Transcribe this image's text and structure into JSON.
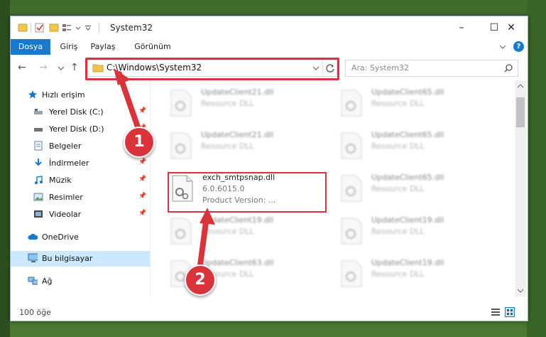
{
  "window": {
    "title": "System32",
    "controls": {
      "minimize": "–",
      "maximize": "☐",
      "close": "✕"
    }
  },
  "ribbon": {
    "tabs": [
      "Dosya",
      "Giriş",
      "Paylaş",
      "Görünüm"
    ],
    "active_tab": "Dosya",
    "help": "?"
  },
  "nav": {
    "address": "C:\\Windows\\System32",
    "search_placeholder": "Ara: System32"
  },
  "sidebar": {
    "items": [
      {
        "label": "Hızlı erişim",
        "icon": "star-icon",
        "pinned": false
      },
      {
        "label": "Yerel Disk (C:)",
        "icon": "drive-icon",
        "pinned": true
      },
      {
        "label": "Yerel Disk (D:)",
        "icon": "drive-icon",
        "pinned": true
      },
      {
        "label": "Belgeler",
        "icon": "document-icon",
        "pinned": true
      },
      {
        "label": "İndirmeler",
        "icon": "download-icon",
        "pinned": true
      },
      {
        "label": "Müzik",
        "icon": "music-icon",
        "pinned": true
      },
      {
        "label": "Resimler",
        "icon": "picture-icon",
        "pinned": true
      },
      {
        "label": "Videolar",
        "icon": "video-icon",
        "pinned": true
      },
      {
        "label": "OneDrive",
        "icon": "cloud-icon",
        "pinned": false
      },
      {
        "label": "Bu bilgisayar",
        "icon": "computer-icon",
        "pinned": false,
        "selected": true
      },
      {
        "label": "Ağ",
        "icon": "network-icon",
        "pinned": false
      }
    ]
  },
  "files": [
    {
      "name": "UpdateClient21.dll",
      "type": "Resource DLL",
      "blurred": true
    },
    {
      "name": "UpdateClient65.dll",
      "type": "Resource DLL",
      "blurred": true
    },
    {
      "name": "UpdateClient21.dll",
      "type": "Resource DLL",
      "blurred": true
    },
    {
      "name": "UpdateClient65.dll",
      "type": "Resource DLL",
      "blurred": true
    },
    {
      "name": "exch_smtpsnap.dll",
      "version": "6.0.6015.0",
      "product_version": "Product Version:    ...",
      "blurred": false
    },
    {
      "name": "UpdateClient65.dll",
      "type": "Resource DLL",
      "blurred": true
    },
    {
      "name": "UpdateClient19.dll",
      "type": "Resource DLL",
      "blurred": true
    },
    {
      "name": "UpdateClient19.dll",
      "type": "Resource DLL",
      "blurred": true
    },
    {
      "name": "UpdateClient63.dll",
      "type": "Resource DLL",
      "blurred": true
    },
    {
      "name": "UpdateClient19.dll",
      "type": "Resource DLL",
      "blurred": true
    }
  ],
  "status": {
    "count": "100 öğe"
  },
  "callouts": {
    "first": "1",
    "second": "2"
  },
  "colors": {
    "accent": "#1979ca",
    "highlight": "#d9343b",
    "selected": "#cce8ff"
  }
}
